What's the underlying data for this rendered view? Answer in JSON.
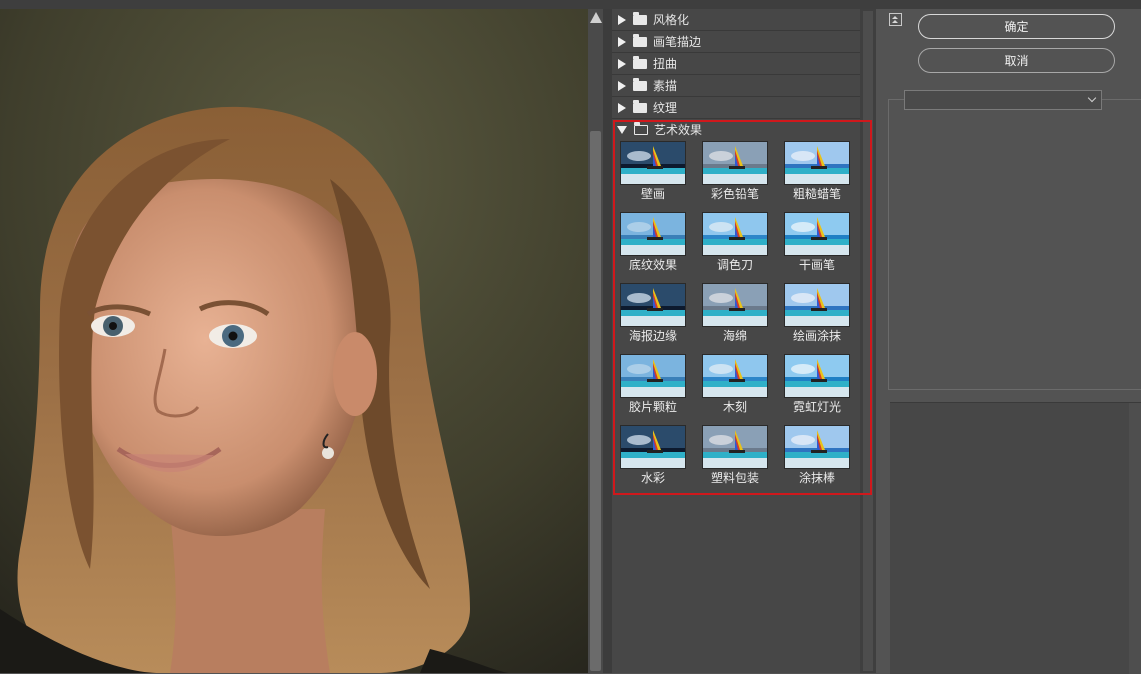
{
  "dialog": {
    "ok_label": "确定",
    "cancel_label": "取消",
    "filter_select_value": ""
  },
  "categories": [
    {
      "label": "风格化",
      "expanded": false
    },
    {
      "label": "画笔描边",
      "expanded": false
    },
    {
      "label": "扭曲",
      "expanded": false
    },
    {
      "label": "素描",
      "expanded": false
    },
    {
      "label": "纹理",
      "expanded": false
    },
    {
      "label": "艺术效果",
      "expanded": true
    }
  ],
  "artistic_filters": [
    {
      "label": "壁画"
    },
    {
      "label": "彩色铅笔"
    },
    {
      "label": "粗糙蜡笔"
    },
    {
      "label": "底纹效果"
    },
    {
      "label": "调色刀"
    },
    {
      "label": "干画笔"
    },
    {
      "label": "海报边缘"
    },
    {
      "label": "海绵"
    },
    {
      "label": "绘画涂抹"
    },
    {
      "label": "胶片颗粒"
    },
    {
      "label": "木刻"
    },
    {
      "label": "霓虹灯光"
    },
    {
      "label": "水彩"
    },
    {
      "label": "塑料包装"
    },
    {
      "label": "涂抹棒"
    }
  ],
  "colors": {
    "highlight_border": "#d0181c",
    "panel_bg": "#535353",
    "tree_bg": "#474747"
  }
}
